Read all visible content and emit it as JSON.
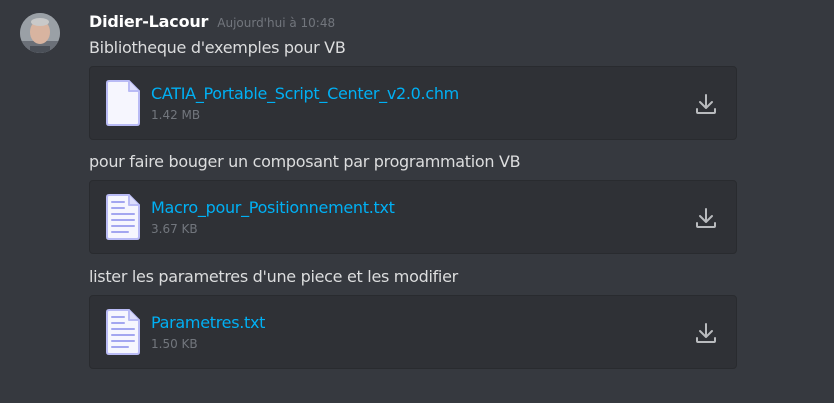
{
  "author": {
    "name": "Didier-Lacour",
    "timestamp": "Aujourd'hui à 10:48",
    "avatar": "user-avatar-photo"
  },
  "messages": [
    {
      "text": "Bibliotheque d'exemples pour VB",
      "file": {
        "name": "CATIA_Portable_Script_Center_v2.0.chm",
        "size": "1.42 MB",
        "icon": "document-icon"
      }
    },
    {
      "text": "pour faire bouger un composant par programmation VB",
      "file": {
        "name": "Macro_pour_Positionnement.txt",
        "size": "3.67 KB",
        "icon": "text-file-icon"
      }
    },
    {
      "text": "lister les parametres d'une piece et les modifier",
      "file": {
        "name": "Parametres.txt",
        "size": "1.50 KB",
        "icon": "text-file-icon"
      }
    }
  ],
  "colors": {
    "background": "#36393f",
    "attachment_bg": "#2f3136",
    "link": "#00b0f4",
    "muted": "#72767d",
    "text": "#dcddde",
    "file_icon": "#b9bbf5"
  }
}
